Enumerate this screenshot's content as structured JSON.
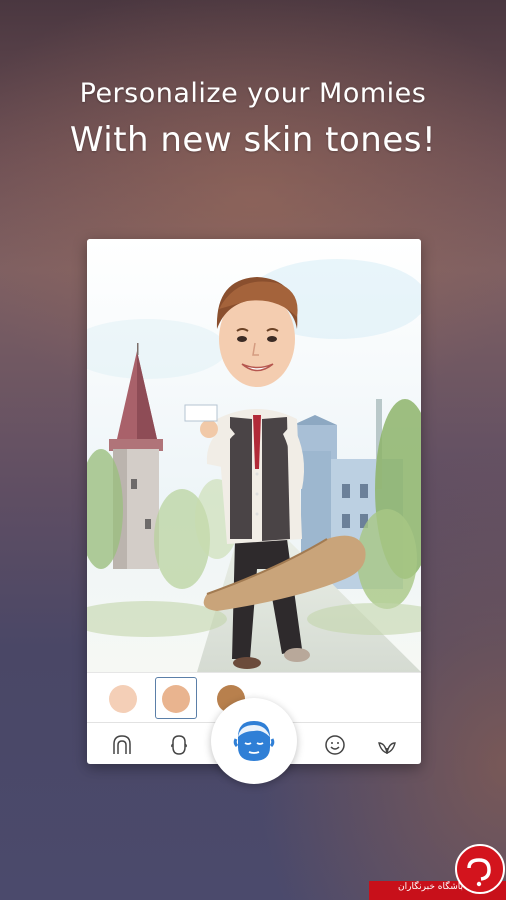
{
  "headline": {
    "line1": "Personalize your Momies",
    "line2": "With new skin tones!"
  },
  "skin_tones": {
    "swatches": [
      {
        "name": "light",
        "color": "#f4cfb7"
      },
      {
        "name": "medium",
        "color": "#e9b48f",
        "selected": true
      },
      {
        "name": "tan",
        "color": "#b8804d"
      }
    ]
  },
  "toolbar": {
    "items": [
      {
        "icon": "hair-icon"
      },
      {
        "icon": "face-shape-icon"
      },
      {
        "icon": "skin-tone-icon",
        "active": true
      },
      {
        "icon": "smiley-icon"
      },
      {
        "icon": "leaf-icon"
      }
    ]
  },
  "colors": {
    "accent": "#2f7fd6",
    "selection_frame": "#5b7fa8",
    "watermark_red": "#c8101a"
  },
  "watermark": {
    "text": "باشگاه خبرنگاران"
  }
}
